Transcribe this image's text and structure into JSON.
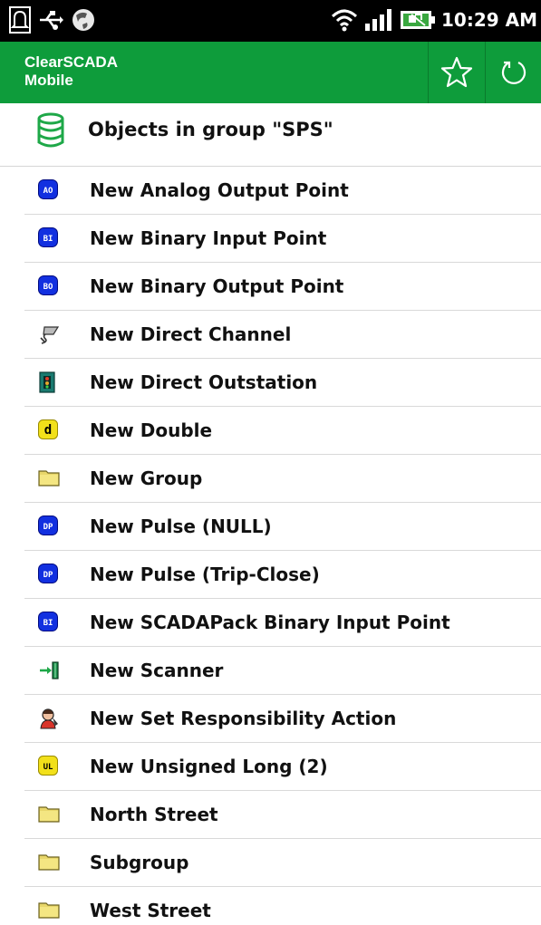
{
  "status_bar": {
    "time": "10:29 AM",
    "icons": [
      "notification-bell-icon",
      "usb-icon",
      "sync-globe-icon",
      "wifi-icon",
      "signal-icon",
      "battery-icon"
    ]
  },
  "action_bar": {
    "title_line1": "ClearSCADA",
    "title_line2": "Mobile",
    "buttons": [
      "star-icon",
      "refresh-icon"
    ],
    "color": "#0e9c3b"
  },
  "header": {
    "title": "Objects in group \"SPS\"",
    "icon": "database-icon"
  },
  "items": [
    {
      "label": "New Analog Output Point",
      "icon": "ao",
      "badge": "AO"
    },
    {
      "label": "New Binary Input Point",
      "icon": "bi",
      "badge": "BI"
    },
    {
      "label": "New Binary Output Point",
      "icon": "bo",
      "badge": "BO"
    },
    {
      "label": "New Direct Channel",
      "icon": "channel",
      "badge": ""
    },
    {
      "label": "New Direct Outstation",
      "icon": "outstation",
      "badge": ""
    },
    {
      "label": "New Double",
      "icon": "double",
      "badge": "d"
    },
    {
      "label": "New Group",
      "icon": "folder",
      "badge": ""
    },
    {
      "label": "New Pulse (NULL)",
      "icon": "dp",
      "badge": "DP"
    },
    {
      "label": "New Pulse (Trip-Close)",
      "icon": "dp",
      "badge": "DP"
    },
    {
      "label": "New SCADAPack Binary Input Point",
      "icon": "bi",
      "badge": "BI"
    },
    {
      "label": "New Scanner",
      "icon": "scanner",
      "badge": ""
    },
    {
      "label": "New Set Responsibility Action",
      "icon": "responsibility",
      "badge": ""
    },
    {
      "label": "New Unsigned Long (2)",
      "icon": "ul",
      "badge": "UL"
    },
    {
      "label": "North Street",
      "icon": "folder",
      "badge": ""
    },
    {
      "label": "Subgroup",
      "icon": "folder",
      "badge": ""
    },
    {
      "label": "West Street",
      "icon": "folder",
      "badge": ""
    }
  ]
}
